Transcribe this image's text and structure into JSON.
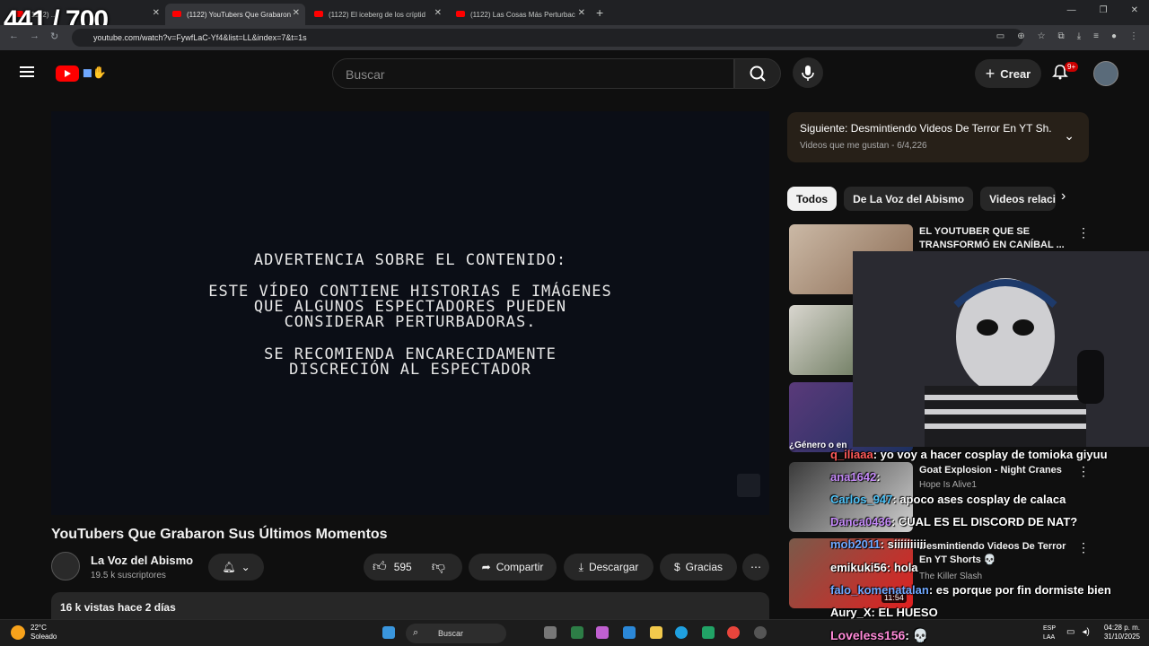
{
  "overlay_counter": "441 / 700",
  "browser": {
    "tabs": [
      {
        "label": "(1122) ...",
        "active": false
      },
      {
        "label": "(1122) YouTubers Que Grabaron",
        "active": true
      },
      {
        "label": "(1122) El iceberg de los críptid",
        "active": false
      },
      {
        "label": "(1122) Las Cosas Más Perturbac",
        "active": false
      }
    ],
    "url": "youtube.com/watch?v=FywfLaC-Yf4&list=LL&index=7&t=1s"
  },
  "header": {
    "search_placeholder": "Buscar",
    "create_label": "Crear",
    "notif_count": "9+"
  },
  "video": {
    "warning_heading": "ADVERTENCIA SOBRE EL CONTENIDO:",
    "warning_line1": "ESTE VÍDEO CONTIENE HISTORIAS E IMÁGENES",
    "warning_line2": "QUE ALGUNOS ESPECTADORES PUEDEN",
    "warning_line3": "CONSIDERAR PERTURBADORAS.",
    "warning_line4": "SE RECOMIENDA ENCARECIDAMENTE",
    "warning_line5": "DISCRECIÓN AL ESPECTADOR",
    "title": "YouTubers Que Grabaron Sus Últimos Momentos",
    "channel": "La Voz del Abismo",
    "subscribers": "19.5 k suscriptores",
    "likes": "595",
    "download_label": "Descargar",
    "share_label": "Compartir",
    "thanks_label": "Gracias",
    "views_date": "16 k vistas  hace 2 días"
  },
  "playlist": {
    "next": "Siguiente: Desmintiendo Videos De Terror En YT Sh...",
    "meta": "Videos que me gustan - 6/4,226"
  },
  "chips": [
    "Todos",
    "De La Voz del Abismo",
    "Videos relacion"
  ],
  "recommended": [
    {
      "title": "EL YOUTUBER QUE SE TRANSFORMÓ EN CANÍBAL ...",
      "channel": ""
    },
    {
      "title": "Goat Explosion - Night Cranes",
      "channel": "Hope Is Alive1"
    },
    {
      "title": "Desmintiendo Videos De Terror En YT Shorts 💀",
      "channel": "The Killer Slash"
    }
  ],
  "duration": "11:54",
  "thumb_caption": "¿Género o en",
  "chat": [
    {
      "user": "q_iliaaa",
      "msg": ": yo voy a hacer cosplay de tomioka giyuu",
      "color": "#ff5a5a"
    },
    {
      "user": "ana1642",
      "msg": ":",
      "color": "#c58af9"
    },
    {
      "user": "Carlos_947",
      "msg": ": apoco ases cosplay de calaca",
      "color": "#4fc3f7"
    },
    {
      "user": "Danca0436",
      "msg": ": CUAL ES EL DISCORD DE NAT?",
      "color": "#c58af9"
    },
    {
      "user": "mob2011",
      "msg": ": siiiiiiiiii",
      "color": "#6fa8ff"
    },
    {
      "user": "emikuki56",
      "msg": ": hola",
      "color": "#ffffff"
    },
    {
      "user": "falo_komenatalan",
      "msg": ": es porque por fin dormiste bien",
      "color": "#6fa8ff"
    },
    {
      "user": "Aury_X",
      "msg": ": EL HUESO",
      "color": "#ffffff"
    },
    {
      "user": "Loveless156",
      "msg": ": 💀",
      "color": "#ff8ad8"
    }
  ],
  "taskbar": {
    "temp": "22°C",
    "weather": "Soleado",
    "search": "Buscar",
    "lang1": "ESP",
    "lang2": "LAA",
    "time": "04:28 p. m.",
    "date": "31/10/2025"
  }
}
